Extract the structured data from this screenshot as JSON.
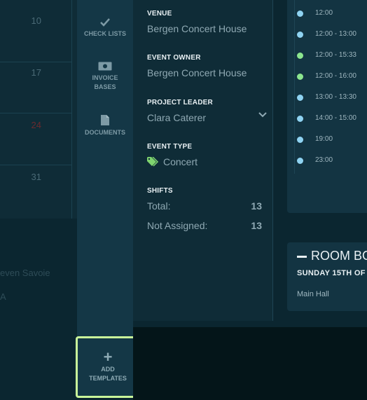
{
  "calendar": {
    "days": [
      "10",
      "17",
      "24",
      "31"
    ],
    "ghost_texts": [
      "even Savoie",
      "A"
    ]
  },
  "sidebar": {
    "items": [
      {
        "label": "CHECK LISTS",
        "icon": "checkmark-icon"
      },
      {
        "label": "INVOICE BASES",
        "icon": "money-icon"
      },
      {
        "label": "DOCUMENTS",
        "icon": "document-icon"
      }
    ],
    "add_button": {
      "label_line1": "ADD",
      "label_line2": "TEMPLATES",
      "icon": "plus-icon"
    }
  },
  "details": {
    "venue": {
      "label": "VENUE",
      "value": "Bergen Concert House"
    },
    "event_owner": {
      "label": "EVENT OWNER",
      "value": "Bergen Concert House"
    },
    "project_leader": {
      "label": "PROJECT LEADER",
      "value": "Clara Caterer"
    },
    "event_type": {
      "label": "EVENT TYPE",
      "value": "Concert",
      "icon": "tag-icon"
    },
    "shifts": {
      "label": "SHIFTS",
      "total_label": "Total:",
      "total_value": "13",
      "not_assigned_label": "Not Assigned:",
      "not_assigned_value": "13"
    }
  },
  "schedule": {
    "times": [
      {
        "time": "12:00",
        "color": "#8fd3f2"
      },
      {
        "time": "12:00 - 13:00",
        "color": "#8fd3f2"
      },
      {
        "time": "12:00 - 15:33",
        "color": "#8ce68f"
      },
      {
        "time": "12:00 - 16:00",
        "color": "#8ce68f"
      },
      {
        "time": "13:00 - 13:30",
        "color": "#8fd3f2"
      },
      {
        "time": "14:00 - 15:00",
        "color": "#8fd3f2"
      },
      {
        "time": "19:00",
        "color": "#8fd3f2"
      },
      {
        "time": "23:00",
        "color": "#8fd3f2"
      }
    ]
  },
  "room_booking": {
    "title": "ROOM BO",
    "date": "SUNDAY 15TH OF",
    "hall": "Main Hall"
  }
}
